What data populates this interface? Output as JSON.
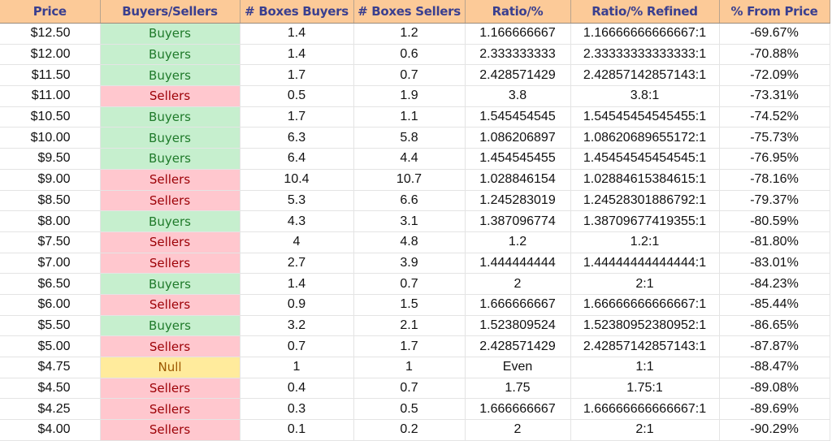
{
  "headers": [
    "Price",
    "Buyers/Sellers",
    "# Boxes Buyers",
    "# Boxes Sellers",
    "Ratio/%",
    "Ratio/% Refined",
    "% From Price"
  ],
  "colors": {
    "header_bg": "#fcca98",
    "header_text": "#3a3f8f",
    "buyers_bg": "#c6efce",
    "buyers_text": "#1f7a2a",
    "sellers_bg": "#ffc7ce",
    "sellers_text": "#9c0006",
    "null_bg": "#ffeb9c",
    "null_text": "#9c5700"
  },
  "rows": [
    [
      "$12.50",
      "Buyers",
      "1.4",
      "1.2",
      "1.166666667",
      "1.16666666666667:1",
      "-69.67%"
    ],
    [
      "$12.00",
      "Buyers",
      "1.4",
      "0.6",
      "2.333333333",
      "2.33333333333333:1",
      "-70.88%"
    ],
    [
      "$11.50",
      "Buyers",
      "1.7",
      "0.7",
      "2.428571429",
      "2.42857142857143:1",
      "-72.09%"
    ],
    [
      "$11.00",
      "Sellers",
      "0.5",
      "1.9",
      "3.8",
      "3.8:1",
      "-73.31%"
    ],
    [
      "$10.50",
      "Buyers",
      "1.7",
      "1.1",
      "1.545454545",
      "1.54545454545455:1",
      "-74.52%"
    ],
    [
      "$10.00",
      "Buyers",
      "6.3",
      "5.8",
      "1.086206897",
      "1.08620689655172:1",
      "-75.73%"
    ],
    [
      "$9.50",
      "Buyers",
      "6.4",
      "4.4",
      "1.454545455",
      "1.45454545454545:1",
      "-76.95%"
    ],
    [
      "$9.00",
      "Sellers",
      "10.4",
      "10.7",
      "1.028846154",
      "1.02884615384615:1",
      "-78.16%"
    ],
    [
      "$8.50",
      "Sellers",
      "5.3",
      "6.6",
      "1.245283019",
      "1.24528301886792:1",
      "-79.37%"
    ],
    [
      "$8.00",
      "Buyers",
      "4.3",
      "3.1",
      "1.387096774",
      "1.38709677419355:1",
      "-80.59%"
    ],
    [
      "$7.50",
      "Sellers",
      "4",
      "4.8",
      "1.2",
      "1.2:1",
      "-81.80%"
    ],
    [
      "$7.00",
      "Sellers",
      "2.7",
      "3.9",
      "1.444444444",
      "1.44444444444444:1",
      "-83.01%"
    ],
    [
      "$6.50",
      "Buyers",
      "1.4",
      "0.7",
      "2",
      "2:1",
      "-84.23%"
    ],
    [
      "$6.00",
      "Sellers",
      "0.9",
      "1.5",
      "1.666666667",
      "1.66666666666667:1",
      "-85.44%"
    ],
    [
      "$5.50",
      "Buyers",
      "3.2",
      "2.1",
      "1.523809524",
      "1.52380952380952:1",
      "-86.65%"
    ],
    [
      "$5.00",
      "Sellers",
      "0.7",
      "1.7",
      "2.428571429",
      "2.42857142857143:1",
      "-87.87%"
    ],
    [
      "$4.75",
      "Null",
      "1",
      "1",
      "Even",
      "1:1",
      "-88.47%"
    ],
    [
      "$4.50",
      "Sellers",
      "0.4",
      "0.7",
      "1.75",
      "1.75:1",
      "-89.08%"
    ],
    [
      "$4.25",
      "Sellers",
      "0.3",
      "0.5",
      "1.666666667",
      "1.66666666666667:1",
      "-89.69%"
    ],
    [
      "$4.00",
      "Sellers",
      "0.1",
      "0.2",
      "2",
      "2:1",
      "-90.29%"
    ]
  ]
}
